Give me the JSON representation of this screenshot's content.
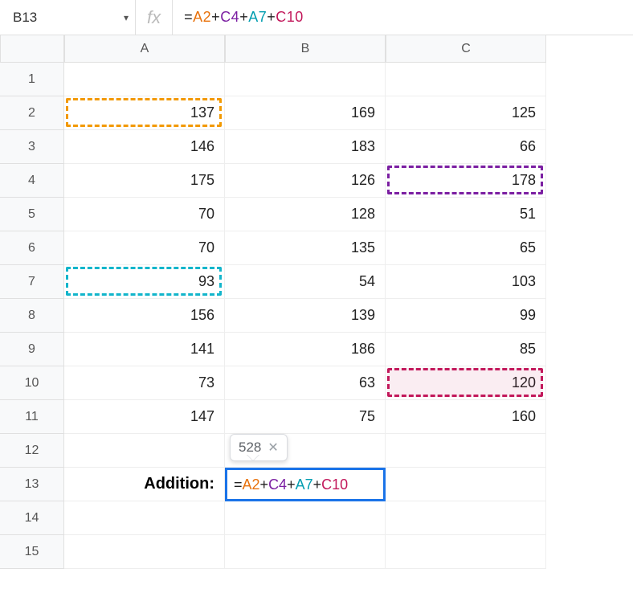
{
  "nameBox": "B13",
  "formulaBar": {
    "prefix": "=",
    "refs": [
      "A2",
      "C4",
      "A7",
      "C10"
    ],
    "op": "+"
  },
  "columns": [
    "A",
    "B",
    "C"
  ],
  "rowCount": 15,
  "data": {
    "2": {
      "A": "137",
      "B": "169",
      "C": "125"
    },
    "3": {
      "A": "146",
      "B": "183",
      "C": "66"
    },
    "4": {
      "A": "175",
      "B": "126",
      "C": "178"
    },
    "5": {
      "A": "70",
      "B": "128",
      "C": "51"
    },
    "6": {
      "A": "70",
      "B": "135",
      "C": "65"
    },
    "7": {
      "A": "93",
      "B": "54",
      "C": "103"
    },
    "8": {
      "A": "156",
      "B": "139",
      "C": "99"
    },
    "9": {
      "A": "141",
      "B": "186",
      "C": "85"
    },
    "10": {
      "A": "73",
      "B": "63",
      "C": "120"
    },
    "11": {
      "A": "147",
      "B": "75",
      "C": "160"
    }
  },
  "labelRow": 13,
  "labelText": "Addition:",
  "tooltipValue": "528",
  "activeFormula": {
    "prefix": "=",
    "parts": [
      {
        "t": "A2",
        "c": "ref-a2"
      },
      {
        "t": "+",
        "c": "op"
      },
      {
        "t": "C4",
        "c": "ref-c4"
      },
      {
        "t": "+",
        "c": "op"
      },
      {
        "t": "A7",
        "c": "ref-a7"
      },
      {
        "t": "+",
        "c": "op"
      },
      {
        "t": "C10",
        "c": "ref-c10"
      }
    ]
  },
  "highlights": [
    {
      "cell": "A2",
      "cls": "d-orange"
    },
    {
      "cell": "A7",
      "cls": "d-teal"
    },
    {
      "cell": "C4",
      "cls": "d-purple"
    },
    {
      "cell": "C10",
      "cls": "d-maroon"
    }
  ]
}
